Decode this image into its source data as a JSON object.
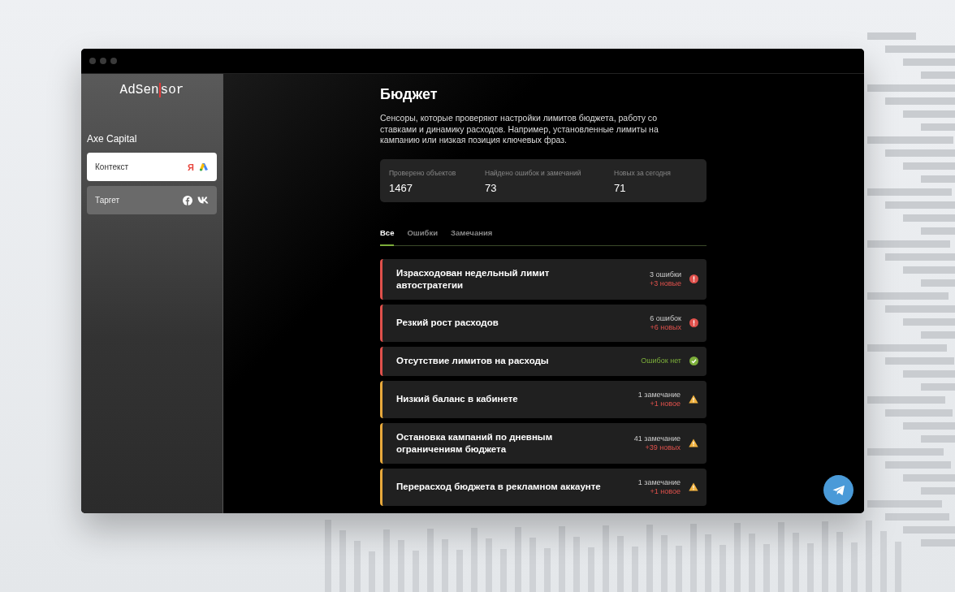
{
  "sidebar": {
    "logo": {
      "before": "AdSen",
      "after": "sor"
    },
    "account": "Axe Capital",
    "items": [
      {
        "label": "Контекст",
        "selected": true,
        "icons": [
          {
            "kind": "letter",
            "text": "Я"
          },
          {
            "kind": "triangle"
          }
        ]
      },
      {
        "label": "Таргет",
        "selected": false,
        "icons": [
          {
            "kind": "f-circle"
          },
          {
            "kind": "vk"
          }
        ]
      }
    ]
  },
  "main": {
    "title": "Бюджет",
    "description": "Сенсоры, которые проверяют настройки лимитов бюджета, работу со ставками и динамику расходов. Например, установленные лимиты на кампанию или низкая позиция ключевых фраз.",
    "stats": [
      {
        "label": "Проверено объектов",
        "value": "1467"
      },
      {
        "label": "Найдено ошибок и замечаний",
        "value": "73"
      },
      {
        "label": "Новых за сегодня",
        "value": "71"
      }
    ],
    "tabs": [
      {
        "label": "Все",
        "selected": true
      },
      {
        "label": "Ошибки",
        "selected": false
      },
      {
        "label": "Замечания",
        "selected": false
      }
    ],
    "sensors": [
      {
        "kind": "error",
        "title": "Израсходован недельный лимит автостратегии",
        "count": "3 ошибки",
        "new": "+3 новые"
      },
      {
        "kind": "error",
        "title": "Резкий рост расходов",
        "count": "6 ошибок",
        "new": "+6 новых"
      },
      {
        "kind": "ok",
        "title": "Отсутствие лимитов на расходы",
        "count": "Ошибок нет"
      },
      {
        "kind": "warning",
        "title": "Низкий баланс в кабинете",
        "count": "1 замечание",
        "new": "+1 новое"
      },
      {
        "kind": "warning",
        "title": "Остановка кампаний по дневным ограничениям бюджета",
        "count": "41 замечание",
        "new": "+39 новых"
      },
      {
        "kind": "warning",
        "title": "Перерасход бюджета в рекламном аккаунте",
        "count": "1 замечание",
        "new": "+1 новое"
      }
    ]
  }
}
